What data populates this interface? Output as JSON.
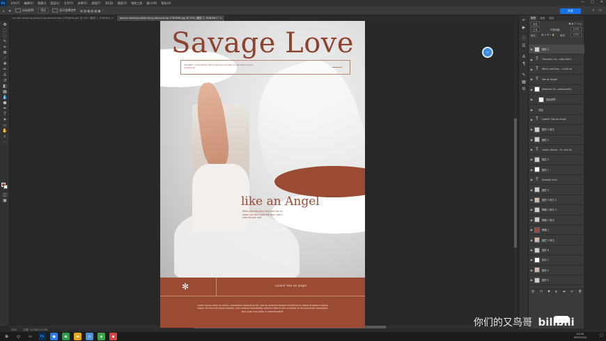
{
  "menubar": {
    "logo": "Ps",
    "items": [
      "文件(F)",
      "编辑(E)",
      "图像(I)",
      "图层(L)",
      "文字(Y)",
      "选择(S)",
      "滤镜(T)",
      "3D(D)",
      "视图(V)",
      "增效工具",
      "窗口(W)",
      "帮助(H)"
    ],
    "controls": [
      "—",
      "□",
      "✕"
    ]
  },
  "options": {
    "auto_select": "自动选择:",
    "layer_select": "图层",
    "show_transform": "显示变换控件",
    "share": "共享"
  },
  "doc_tabs": [
    {
      "label": "person-wearing-white-long-sleeved-top-2784896.psd @ 25% (图层 1, RGB/8#) ×",
      "active": false
    },
    {
      "label": "person-wearing-white-long-sleeved-top-2784896.jpg @ 25% (图层 2, RGB/8#) * ×",
      "active": true
    }
  ],
  "poster": {
    "title": "Savage Love",
    "title_box_text": "Thought I could slowly don't need you to Lean on me when you're not strong",
    "subtitle": "like an Angel",
    "body_text": "When you kiss me I can't eat like an angel you don't give me love I don't want to love now",
    "footer_label": "Lookin' like an angel",
    "footer_body": "Lorem ipsum dolor sit amet, consectetur adipiscing elit, sed do eiusmod tempor incididunt ut labore et dolore magna aliqua. Ut enim ad minim veniam, quis nostrud exercitation ullamco laboris nisi ut aliquip ex ea commodo consequat. Duis aute irure dolor in reprehenderit.",
    "colors": {
      "accent": "#9b4a33",
      "white": "#ffffff"
    }
  },
  "panel": {
    "tabs": [
      "图层",
      "通道",
      "路径"
    ],
    "filter": "类型",
    "blend_mode": "正常",
    "opacity_label": "不透明度:",
    "opacity": "100%",
    "lock_label": "锁定:",
    "fill_label": "填充:",
    "fill": "100%",
    "layers": [
      {
        "name": "图层 2",
        "thumb": "img",
        "selected": true
      },
      {
        "name": "Thought I co...ually don't",
        "thumb": "t"
      },
      {
        "name": "When you kiss...I c;eill ea",
        "thumb": "t"
      },
      {
        "name": "like an Angel",
        "thumb": "t"
      },
      {
        "name": "Abstract Sh...onquarent1",
        "thumb": "white"
      },
      {
        "name": "智能滤镜",
        "thumb": "white",
        "indent": true
      },
      {
        "name": "扭曲",
        "thumb": "none",
        "indent": true
      },
      {
        "name": "Lookin' like an angel",
        "thumb": "t"
      },
      {
        "name": "图层 4 拷贝",
        "thumb": "img"
      },
      {
        "name": "图层 4",
        "thumb": "img"
      },
      {
        "name": "Lorem ipsum ...iti, sed do",
        "thumb": "t"
      },
      {
        "name": "图层 3",
        "thumb": "img"
      },
      {
        "name": "图层 1",
        "thumb": "white"
      },
      {
        "name": "Savage Love",
        "thumb": "t"
      },
      {
        "name": "图层 5",
        "thumb": "img"
      },
      {
        "name": "图层 3 拷贝 2",
        "thumb": "photo"
      },
      {
        "name": "椭圆 2 拷贝 2",
        "thumb": "img"
      },
      {
        "name": "椭圆 2 拷贝",
        "thumb": "img"
      },
      {
        "name": "椭圆 2",
        "thumb": "brown"
      },
      {
        "name": "图层 2 拷贝",
        "thumb": "photo"
      },
      {
        "name": "图层 6",
        "thumb": "img"
      },
      {
        "name": "矩形 1",
        "thumb": "white"
      },
      {
        "name": "图层 0",
        "thumb": "photo"
      },
      {
        "name": "图层 0",
        "thumb": "img"
      }
    ],
    "bottom_icons": [
      "link-icon",
      "fx-icon",
      "mask-icon",
      "adjust-icon",
      "folder-icon",
      "new-layer-icon",
      "trash-icon"
    ]
  },
  "status": {
    "zoom": "25%",
    "doc_info": "文档: 14.5M/114.9M"
  },
  "taskbar": {
    "time": "14:56",
    "date": "2020/10/4"
  },
  "watermark": {
    "text": "你们的又鸟哥",
    "brand": "bilibili"
  },
  "cursor_label": "Ps"
}
